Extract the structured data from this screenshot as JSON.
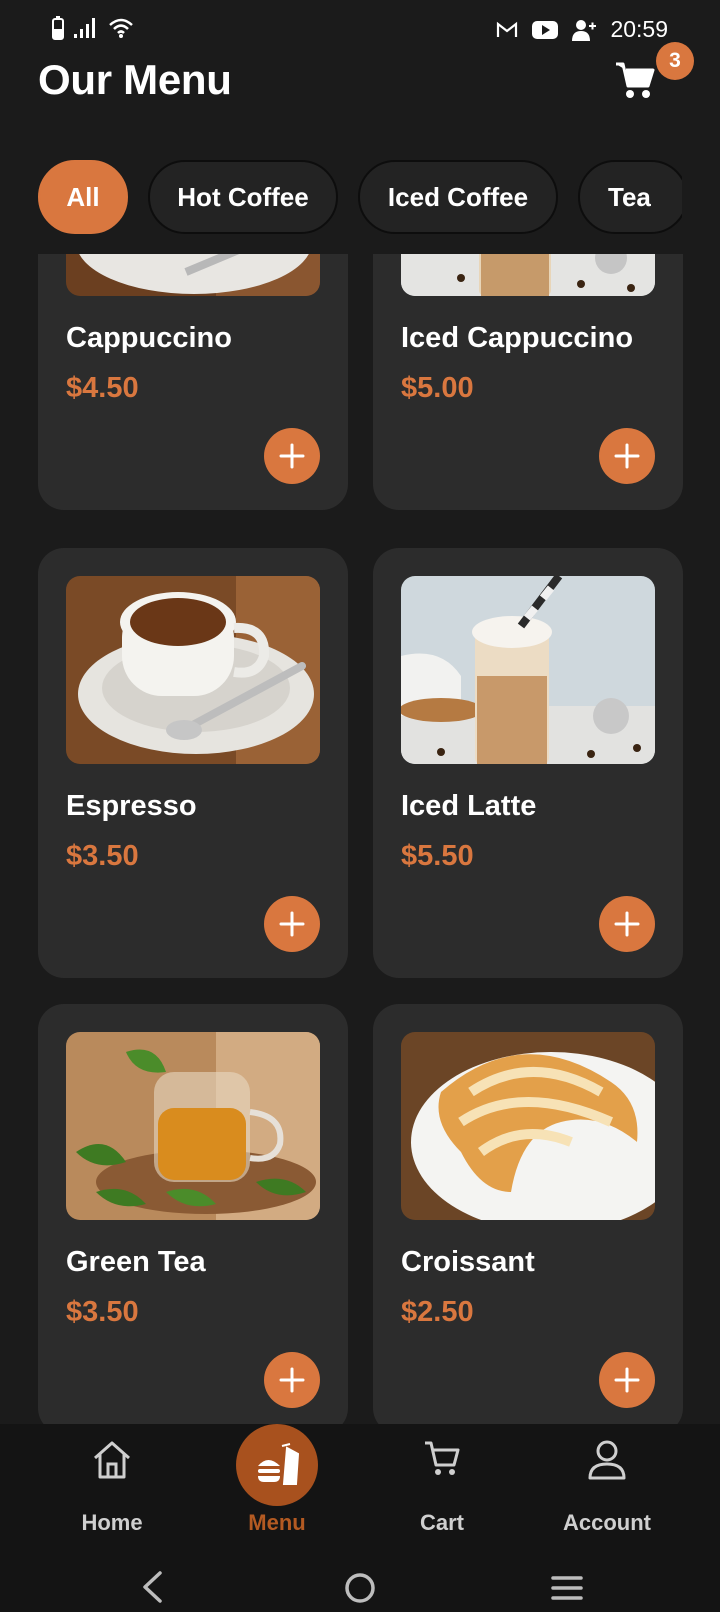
{
  "status": {
    "time": "20:59"
  },
  "header": {
    "title": "Our Menu",
    "cart_count": "3"
  },
  "categories": [
    {
      "label": "All",
      "active": true
    },
    {
      "label": "Hot Coffee",
      "active": false
    },
    {
      "label": "Iced Coffee",
      "active": false
    },
    {
      "label": "Tea",
      "active": false
    }
  ],
  "products": [
    {
      "name": "Cappuccino",
      "price": "$4.50",
      "image": "hot-coffee-cup"
    },
    {
      "name": "Iced Cappuccino",
      "price": "$5.00",
      "image": "iced-coffee-glass"
    },
    {
      "name": "Espresso",
      "price": "$3.50",
      "image": "hot-coffee-cup"
    },
    {
      "name": "Iced Latte",
      "price": "$5.50",
      "image": "iced-coffee-glass"
    },
    {
      "name": "Green Tea",
      "price": "$3.50",
      "image": "tea-glass"
    },
    {
      "name": "Croissant",
      "price": "$2.50",
      "image": "croissant"
    }
  ],
  "nav": {
    "home": "Home",
    "menu": "Menu",
    "cart": "Cart",
    "account": "Account"
  },
  "colors": {
    "accent": "#d9773f",
    "background": "#1b1b1b",
    "card": "#2c2c2c"
  }
}
